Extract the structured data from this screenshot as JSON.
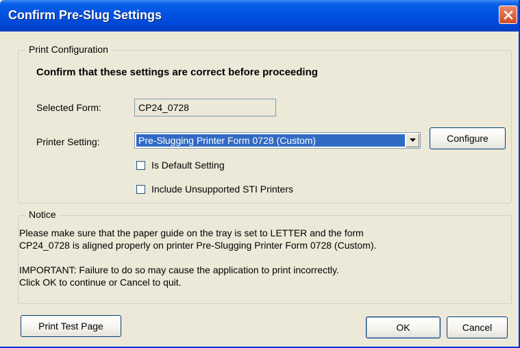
{
  "window": {
    "title": "Confirm Pre-Slug Settings"
  },
  "print_configuration": {
    "legend": "Print Configuration",
    "heading": "Confirm that these settings are correct before proceeding",
    "selected_form_label": "Selected Form:",
    "selected_form_value": "CP24_0728",
    "printer_setting_label": "Printer Setting:",
    "printer_setting_value": "Pre-Slugging Printer Form 0728 (Custom)",
    "configure_label": "Configure",
    "is_default_label": "Is Default Setting",
    "is_default_checked": false,
    "include_unsupported_label": "Include Unsupported STI Printers",
    "include_unsupported_checked": false
  },
  "notice": {
    "legend": "Notice",
    "line1": "Please make sure that the paper guide on the tray is set to LETTER and the form",
    "line2": "CP24_0728 is aligned properly on printer Pre-Slugging Printer Form 0728 (Custom).",
    "line3": "IMPORTANT: Failure to do so may cause the application to print incorrectly.",
    "line4": "Click OK to continue or Cancel to quit."
  },
  "buttons": {
    "print_test_page": "Print Test Page",
    "ok": "OK",
    "cancel": "Cancel"
  },
  "colors": {
    "title_bar": "#0052E0",
    "dialog_bg": "#ECE9D8",
    "selection": "#316AC5",
    "close_button": "#D14A24"
  }
}
